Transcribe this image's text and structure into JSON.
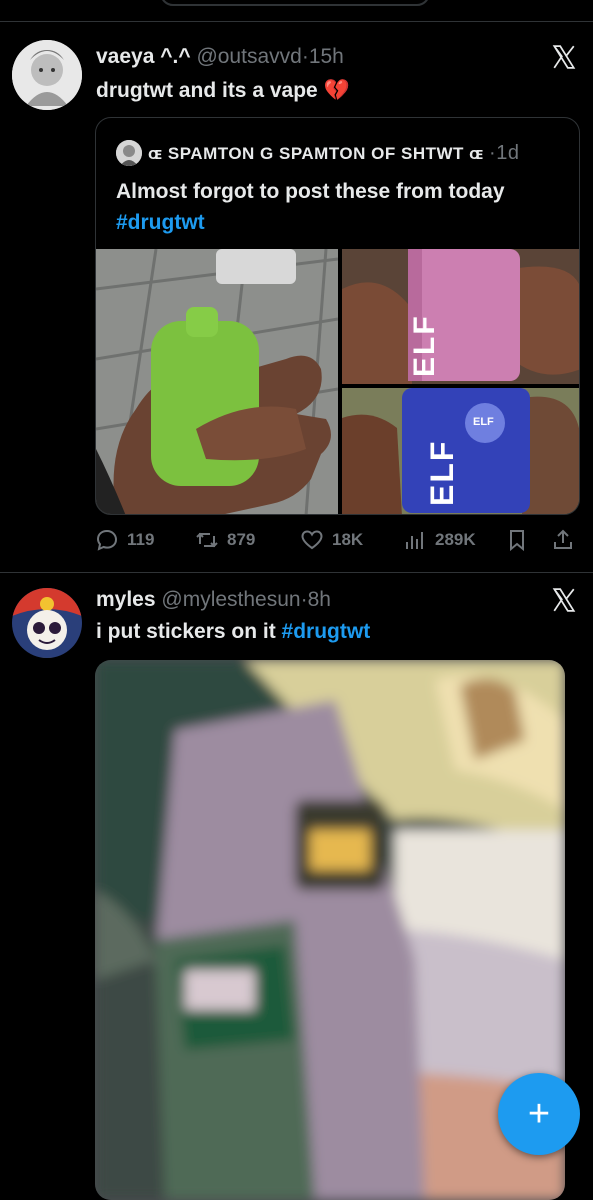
{
  "post1": {
    "display_name": "vaeya ^.^",
    "handle": "@outsavvd",
    "separator": "·",
    "time": "15h",
    "text": "drugtwt and its a vape",
    "emoji": "💔",
    "quote": {
      "name": "ɶ SPAMTON G SPAMTON OF SHTWT ɶ",
      "separator": "·",
      "time": "1d",
      "text": "Almost forgot to post these from today ",
      "hashtag": "#drugtwt",
      "media_labels": {
        "brand_pink": "ELF",
        "brand_blue": "ELF",
        "blue_badge": "ELF"
      }
    },
    "actions": {
      "replies": "119",
      "reposts": "879",
      "likes": "18K",
      "views": "289K"
    }
  },
  "post2": {
    "display_name": "myles",
    "handle": "@mylesthesun",
    "separator": "·",
    "time": "8h",
    "text": "i put stickers on it ",
    "hashtag": "#drugtwt"
  },
  "fab": {
    "label": "+"
  },
  "colors": {
    "background": "#000000",
    "text_primary": "#e7e9ea",
    "text_secondary": "#71767b",
    "accent": "#1d9bf0",
    "border": "#2f3336",
    "emoji_heart": "#d9244a"
  },
  "icons": {
    "brand": "x-logo-icon",
    "reply": "reply-icon",
    "repost": "repost-icon",
    "like": "heart-icon",
    "views": "views-chart-icon",
    "bookmark": "bookmark-icon",
    "share": "share-icon",
    "compose": "plus-icon"
  }
}
